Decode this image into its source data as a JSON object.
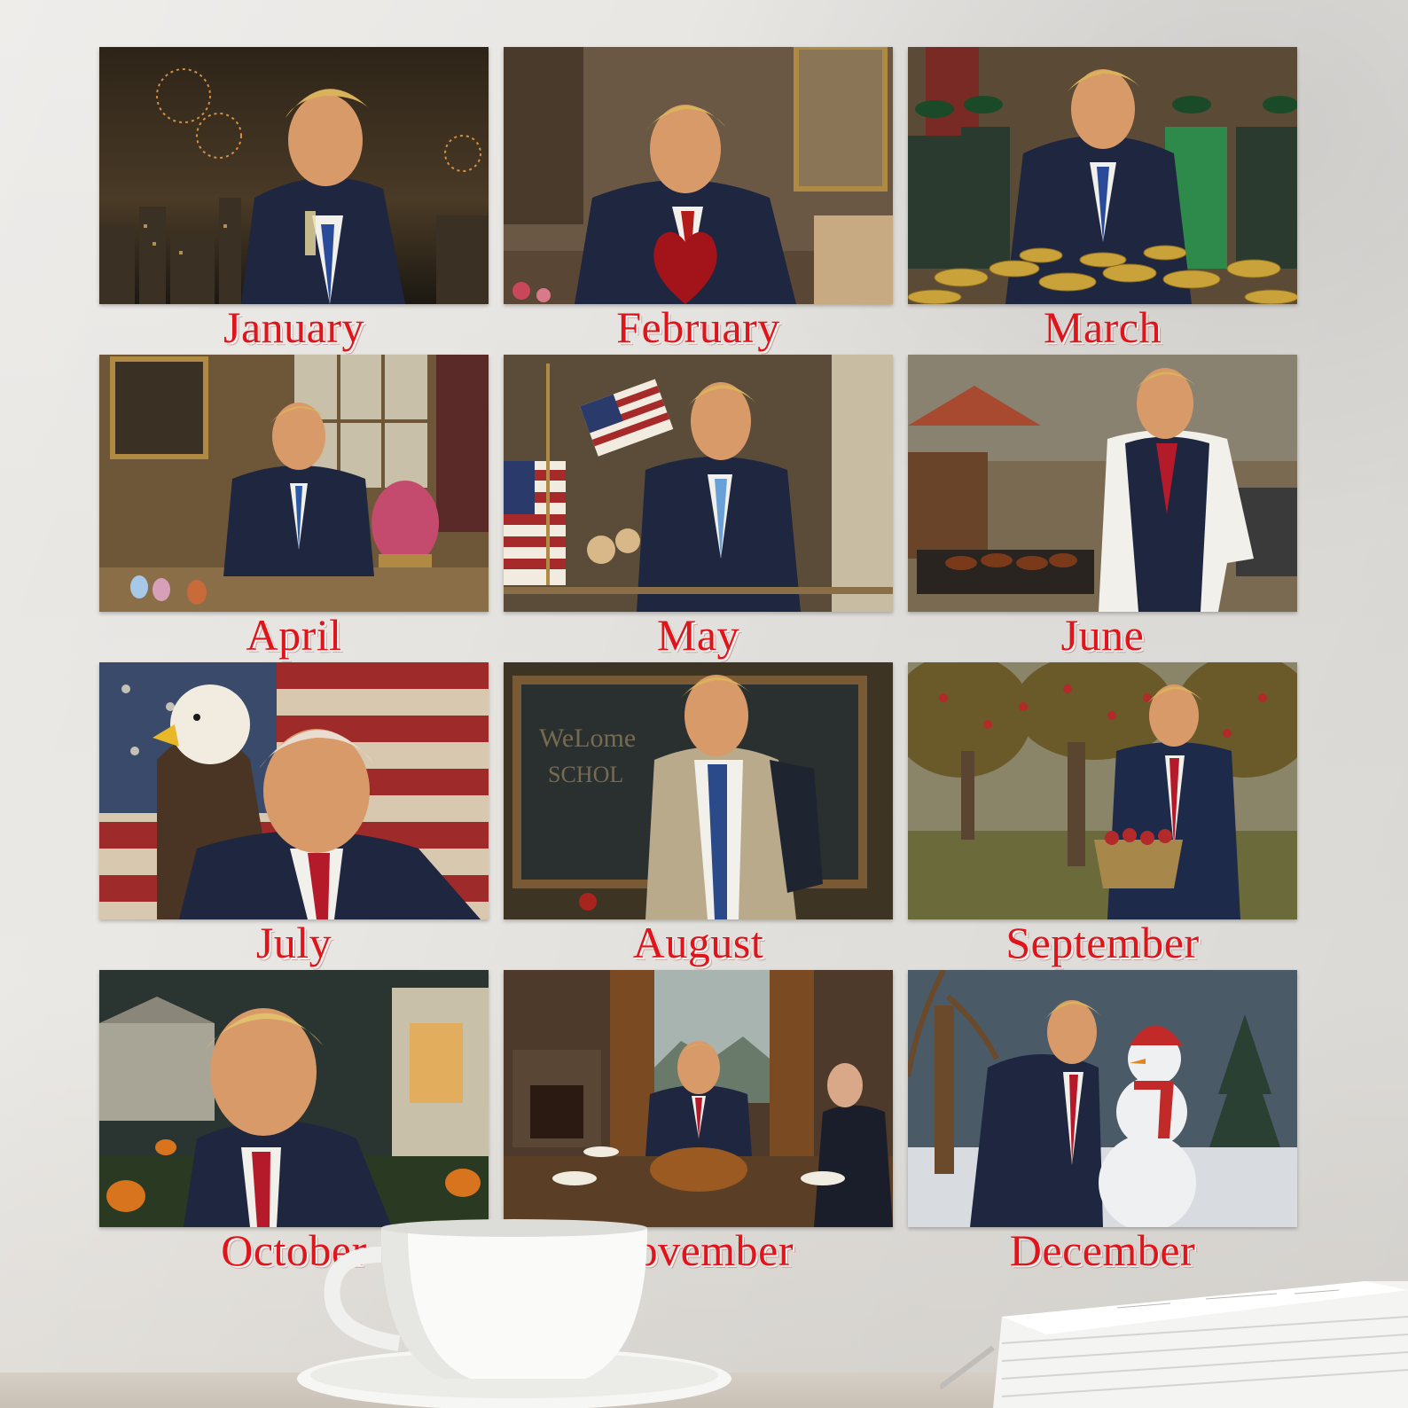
{
  "months": [
    {
      "label": "January",
      "scene": "fireworks-city-night",
      "bg": "#2a2620",
      "accent": "#d98a3a"
    },
    {
      "label": "February",
      "scene": "valentine-heart-desk",
      "bg": "#5a4a3a",
      "accent": "#b51a1a"
    },
    {
      "label": "March",
      "scene": "gold-coins-green-hats",
      "bg": "#4a3e2e",
      "accent": "#c9a23a"
    },
    {
      "label": "April",
      "scene": "easter-egg-office",
      "bg": "#5e4a32",
      "accent": "#c44a6e"
    },
    {
      "label": "May",
      "scene": "flags-memorial",
      "bg": "#4a4030",
      "accent": "#3a4a7a"
    },
    {
      "label": "June",
      "scene": "barbecue-grill",
      "bg": "#6a5a44",
      "accent": "#a33a2a"
    },
    {
      "label": "July",
      "scene": "eagle-flag",
      "bg": "#6a4a3a",
      "accent": "#9e2a2a"
    },
    {
      "label": "August",
      "scene": "back-to-school",
      "bg": "#3a3a30",
      "accent": "#2e4a7a"
    },
    {
      "label": "September",
      "scene": "apple-orchard",
      "bg": "#6a6446",
      "accent": "#b22a2a"
    },
    {
      "label": "October",
      "scene": "halloween-pumpkins",
      "bg": "#2e3a34",
      "accent": "#d9741e"
    },
    {
      "label": "November",
      "scene": "thanksgiving-dinner",
      "bg": "#4e3a2a",
      "accent": "#b5722a"
    },
    {
      "label": "December",
      "scene": "snowman-winter",
      "bg": "#3e4a52",
      "accent": "#c22a2a"
    }
  ],
  "colors": {
    "label": "#e0141b",
    "wall": "#e7e5e1",
    "suit": "#1e2640",
    "hair": "#d9b25a",
    "skin": "#d99a6a"
  }
}
